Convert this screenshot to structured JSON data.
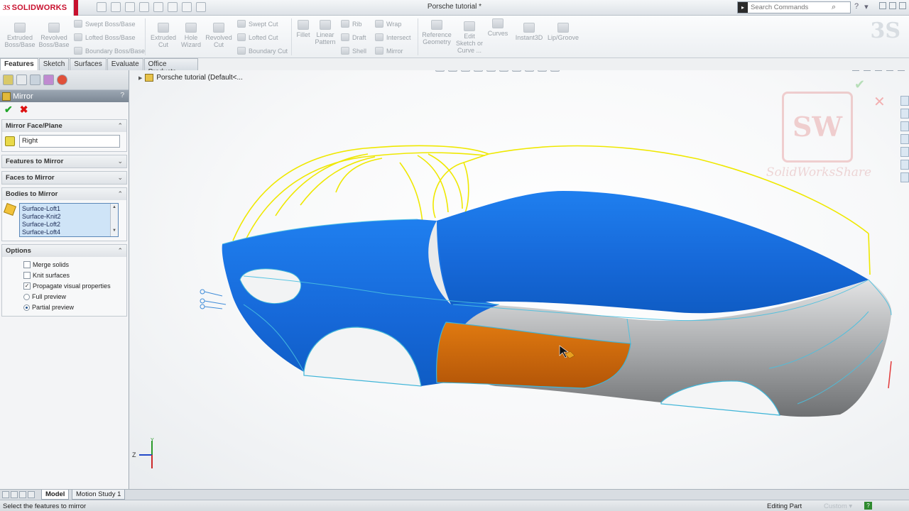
{
  "app": {
    "logo_ds": "3S",
    "logo_name": "SOLIDWORKS",
    "document_title": "Porsche tutorial *"
  },
  "search": {
    "placeholder": "Search Commands"
  },
  "toolbar": {
    "extruded_boss": "Extruded Boss/Base",
    "revolved_boss": "Revolved Boss/Base",
    "swept_boss": "Swept Boss/Base",
    "lofted_boss": "Lofted Boss/Base",
    "boundary_boss": "Boundary Boss/Base",
    "extruded_cut": "Extruded Cut",
    "hole_wizard": "Hole Wizard",
    "revolved_cut": "Revolved Cut",
    "swept_cut": "Swept Cut",
    "lofted_cut": "Lofted Cut",
    "boundary_cut": "Boundary Cut",
    "fillet": "Fillet",
    "linear_pattern": "Linear Pattern",
    "rib": "Rib",
    "draft": "Draft",
    "shell": "Shell",
    "wrap": "Wrap",
    "intersect": "Intersect",
    "mirror": "Mirror",
    "reference_geometry": "Reference Geometry",
    "edit_sketch": "Edit Sketch or Curve ...",
    "curves": "Curves",
    "instant3d": "Instant3D",
    "lip_groove": "Lip/Groove"
  },
  "tabs": [
    "Features",
    "Sketch",
    "Surfaces",
    "Evaluate",
    "Office Products"
  ],
  "property_manager": {
    "title": "Mirror",
    "help": "?",
    "mirror_face_plane": {
      "heading": "Mirror Face/Plane",
      "value": "Right"
    },
    "features_to_mirror": "Features to Mirror",
    "faces_to_mirror": "Faces to Mirror",
    "bodies_to_mirror": {
      "heading": "Bodies to Mirror",
      "items": [
        "Surface-Loft1",
        "Surface-Knit2",
        "Surface-Loft2",
        "Surface-Loft4"
      ]
    },
    "options": {
      "heading": "Options",
      "merge_solids": "Merge solids",
      "knit_surfaces": "Knit surfaces",
      "propagate": "Propagate visual properties",
      "full_preview": "Full preview",
      "partial_preview": "Partial preview"
    }
  },
  "viewport": {
    "tree_label": "Porsche tutorial  (Default<...",
    "watermark_caption": "SolidWorksShare",
    "watermark_badge": "SW"
  },
  "triad": {
    "y": "Y",
    "z": "Z"
  },
  "bottom_tabs": [
    "Model",
    "Motion Study 1"
  ],
  "status": {
    "left": "Select the features to mirror",
    "mid": "Editing Part",
    "custom": "Custom ▾",
    "help": "?"
  },
  "colors": {
    "body_blue": "#1a78e6",
    "selected_orange": "#d46a0c",
    "body_grey": "#a8aaac",
    "sketch_yellow": "#f0ec00"
  }
}
